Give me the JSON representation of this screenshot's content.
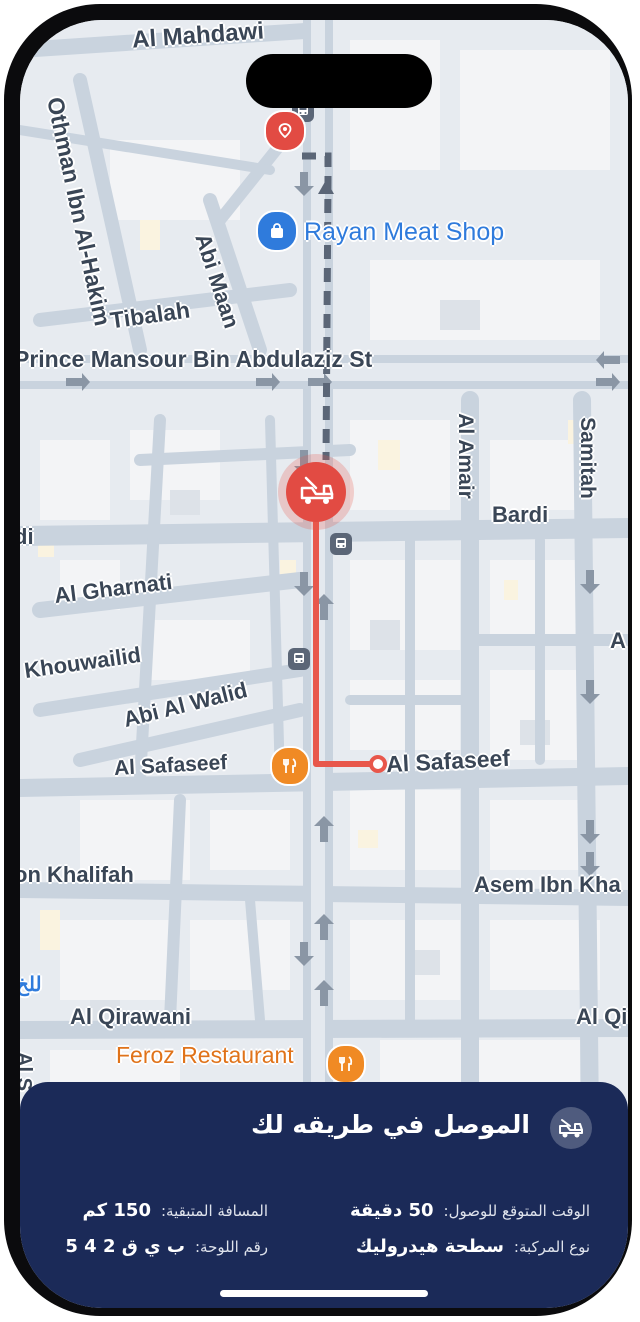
{
  "map": {
    "streets": {
      "al_mahdawi": "Al Mahdawi",
      "othman": "Othman Ibn Al-Hakim",
      "abi_maan": "Abi Maan",
      "tibalah": "Tibalah",
      "prince_mansour": "Prince Mansour Bin Abdulaziz St",
      "al_amair": "Al Amair",
      "samitah": "Samitah",
      "bardi": "Bardi",
      "di": "di",
      "al_gharnati": "Al Gharnati",
      "khouwailid": "Khouwailid",
      "abi_al_walid": "Abi Al Walid",
      "al_safaseef_left": "Al Safaseef",
      "al_safaseef_right": "Al Safaseef",
      "on_khalifah": "on Khalifah",
      "asem": "Asem Ibn Kha",
      "al_qirawani": "Al Qirawani",
      "al_qi": "Al Qi",
      "edge_a": "A",
      "edge_al_l": "للخ",
      "edge_al_s": "Al S"
    },
    "pois": {
      "rayan": "Rayan Meat Shop",
      "feroz": "Feroz Restaurant"
    },
    "colors": {
      "route": "#e8574b",
      "pin_red": "#e24b43",
      "shop_blue": "#2f7bdc",
      "food_orange": "#f08a24",
      "poi_text_blue": "#2f7bdc",
      "poi_text_orange": "#e0731a"
    }
  },
  "sheet": {
    "icon": "tow-truck-icon",
    "title": "الموصل في طريقه لك",
    "eta_label": "الوقت المتوقع للوصول:",
    "eta_value": "50 دقيقة",
    "distance_label": "المسافة المتبقية:",
    "distance_value": "150 كم",
    "vehicle_label": "نوع المركبة:",
    "vehicle_value": "سطحة هيدروليك",
    "plate_label": "رقم اللوحة:",
    "plate_value": "ب ي ق 2 4 5"
  }
}
